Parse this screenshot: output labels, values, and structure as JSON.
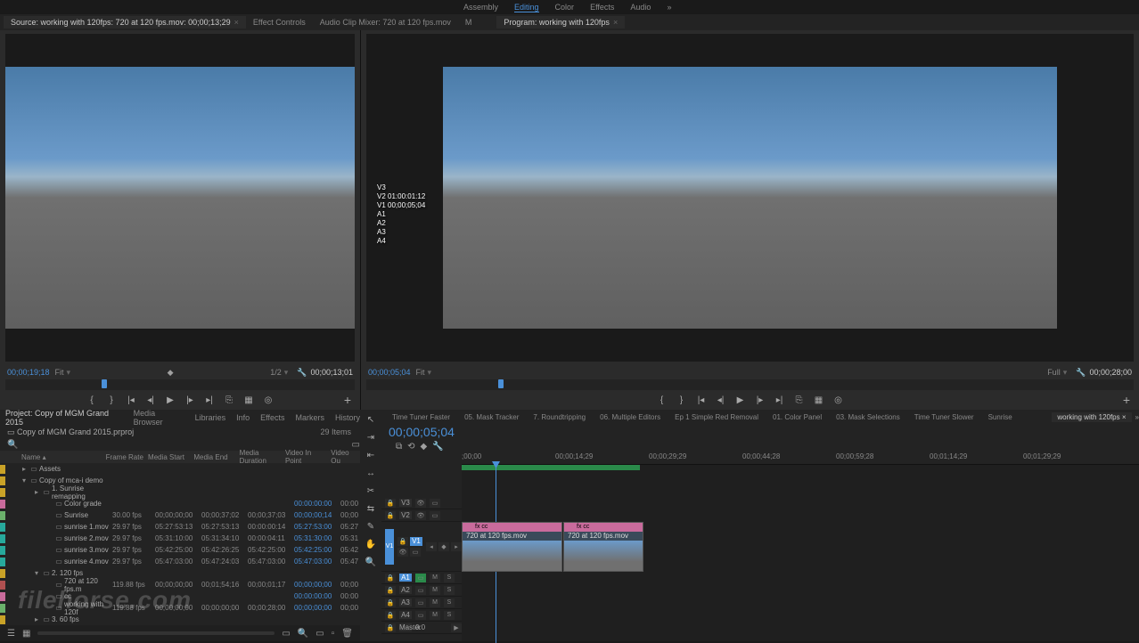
{
  "workspace": {
    "items": [
      "Assembly",
      "Editing",
      "Color",
      "Effects",
      "Audio"
    ],
    "active": "Editing",
    "overflow": "»"
  },
  "source_panel": {
    "tabs": {
      "source": "Source: working with 120fps: 720 at 120 fps.mov: 00;00;13;29",
      "effect_controls": "Effect Controls",
      "audio_mixer": "Audio Clip Mixer: 720 at 120 fps.mov",
      "metadata": "M"
    },
    "tc_left": "00;00;19;18",
    "fit": "Fit",
    "zoom": "1/2",
    "tc_right": "00;00;13;01"
  },
  "program_panel": {
    "tab": "Program: working with 120fps",
    "overlay": [
      "V3",
      "V2 01:00:01:12",
      "V1 00;00;05;04",
      "A1",
      "A2",
      "A3",
      "A4"
    ],
    "tc_left": "00;00;05;04",
    "fit": "Fit",
    "zoom": "Full",
    "tc_right": "00;00;28;00"
  },
  "transport": {
    "icons": [
      "mark-in",
      "mark-out",
      "go-in",
      "step-back",
      "play",
      "step-fwd",
      "go-out",
      "lift",
      "extract",
      "export-frame"
    ]
  },
  "project": {
    "tabs": [
      "Project: Copy of MGM Grand 2015",
      "Media Browser",
      "Libraries",
      "Info",
      "Effects",
      "Markers",
      "History"
    ],
    "project_file": "Copy of MGM Grand 2015.prproj",
    "item_count": "29 Items",
    "columns": [
      "Name",
      "Frame Rate",
      "Media Start",
      "Media End",
      "Media Duration",
      "Video In Point",
      "Video Ou"
    ],
    "rows": [
      {
        "swatch": "sw-yellow",
        "indent": 1,
        "twisty": "▸",
        "icon": "▭",
        "name": "Assets"
      },
      {
        "swatch": "sw-yellow",
        "indent": 1,
        "twisty": "▾",
        "icon": "▭",
        "name": "Copy of mca-i demo"
      },
      {
        "swatch": "sw-yellow",
        "indent": 2,
        "twisty": "▸",
        "icon": "▭",
        "name": "1. Sunrise remapping"
      },
      {
        "swatch": "sw-pink",
        "indent": 3,
        "icon": "▭",
        "name": "Color grade",
        "in_blue": "00:00:00:00",
        "out": "00:00"
      },
      {
        "swatch": "sw-green",
        "indent": 3,
        "icon": "▭",
        "name": "Sunrise",
        "fps": "30.00 fps",
        "start": "00;00;00;00",
        "end": "00;00;37;02",
        "dur": "00;00;37;03",
        "in_blue": "00;00;00;14",
        "out": "00;00"
      },
      {
        "swatch": "sw-teal",
        "indent": 3,
        "icon": "▭",
        "name": "sunrise 1.mov",
        "fps": "29.97 fps",
        "start": "05:27:53:13",
        "end": "05:27:53:13",
        "dur": "00:00:00:14",
        "in_blue": "05:27:53:00",
        "out": "05:27"
      },
      {
        "swatch": "sw-teal",
        "indent": 3,
        "icon": "▭",
        "name": "sunrise 2.mov",
        "fps": "29.97 fps",
        "start": "05:31:10:00",
        "end": "05:31:34:10",
        "dur": "00:00:04:11",
        "in_blue": "05:31:30:00",
        "out": "05:31"
      },
      {
        "swatch": "sw-teal",
        "indent": 3,
        "icon": "▭",
        "name": "sunrise 3.mov",
        "fps": "29.97 fps",
        "start": "05:42:25:00",
        "end": "05:42:26:25",
        "dur": "05:42:25:00",
        "in_blue": "05:42:25:00",
        "out": "05:42"
      },
      {
        "swatch": "sw-teal",
        "indent": 3,
        "icon": "▭",
        "name": "sunrise 4.mov",
        "fps": "29.97 fps",
        "start": "05:47:03:00",
        "end": "05:47:24:03",
        "dur": "05:47:03:00",
        "in_blue": "05:47:03:00",
        "out": "05:47"
      },
      {
        "swatch": "sw-yellow",
        "indent": 2,
        "twisty": "▾",
        "icon": "▭",
        "name": "2. 120 fps"
      },
      {
        "swatch": "sw-red",
        "indent": 3,
        "icon": "▭",
        "name": "720 at 120 fps.m",
        "fps": "119.88 fps",
        "start": "00;00;00;00",
        "end": "00;01;54;16",
        "dur": "00;00;01;17",
        "in_blue": "00;00;00;00",
        "out": "00;00"
      },
      {
        "swatch": "sw-pink",
        "indent": 3,
        "icon": "▭",
        "name": "cc",
        "in_blue": "00:00:00:00",
        "out": "00:00"
      },
      {
        "swatch": "sw-green",
        "indent": 3,
        "icon": "▭",
        "name": "working with 120f",
        "fps": "119.88 fps",
        "start": "00;00;00;00",
        "end": "00;00;00;00",
        "dur": "00;00;28;00",
        "in_blue": "00;00;00;00",
        "out": "00;00"
      },
      {
        "swatch": "sw-yellow",
        "indent": 2,
        "twisty": "▸",
        "icon": "▭",
        "name": "3. 60 fps"
      }
    ]
  },
  "tools": [
    "selection",
    "track-select",
    "ripple",
    "rolling",
    "rate",
    "razor",
    "slip",
    "slide",
    "pen",
    "hand",
    "zoom",
    "type"
  ],
  "timeline": {
    "tabs": [
      "Time Tuner Faster",
      "05. Mask Tracker",
      "7. Roundtripping",
      "06. Multiple Editors",
      "Ep 1 Simple Red Removal",
      "01. Color Panel",
      "03. Mask Selections",
      "Time Tuner Slower",
      "Sunrise",
      "working with 120fps"
    ],
    "active_tab": "working with 120fps",
    "playhead_tc": "00;00;05;04",
    "ruler": [
      ";00;00",
      "00;00;14;29",
      "00;00;29;29",
      "00;00;44;28",
      "00;00;59;28",
      "00;01;14;29",
      "00;01;29;29"
    ],
    "clip1": {
      "fx": "fx cc",
      "title": "720 at 120 fps.mov"
    },
    "clip2": {
      "fx": "fx cc",
      "title": "720 at 120 fps.mov"
    },
    "tracks": {
      "v3": "V3",
      "v2": "V2",
      "v1": "V1",
      "a1": "A1",
      "a2": "A2",
      "a3": "A3",
      "a4": "A4",
      "master": "Master",
      "master_val": "0.0"
    }
  },
  "watermark": "filehorse.com"
}
